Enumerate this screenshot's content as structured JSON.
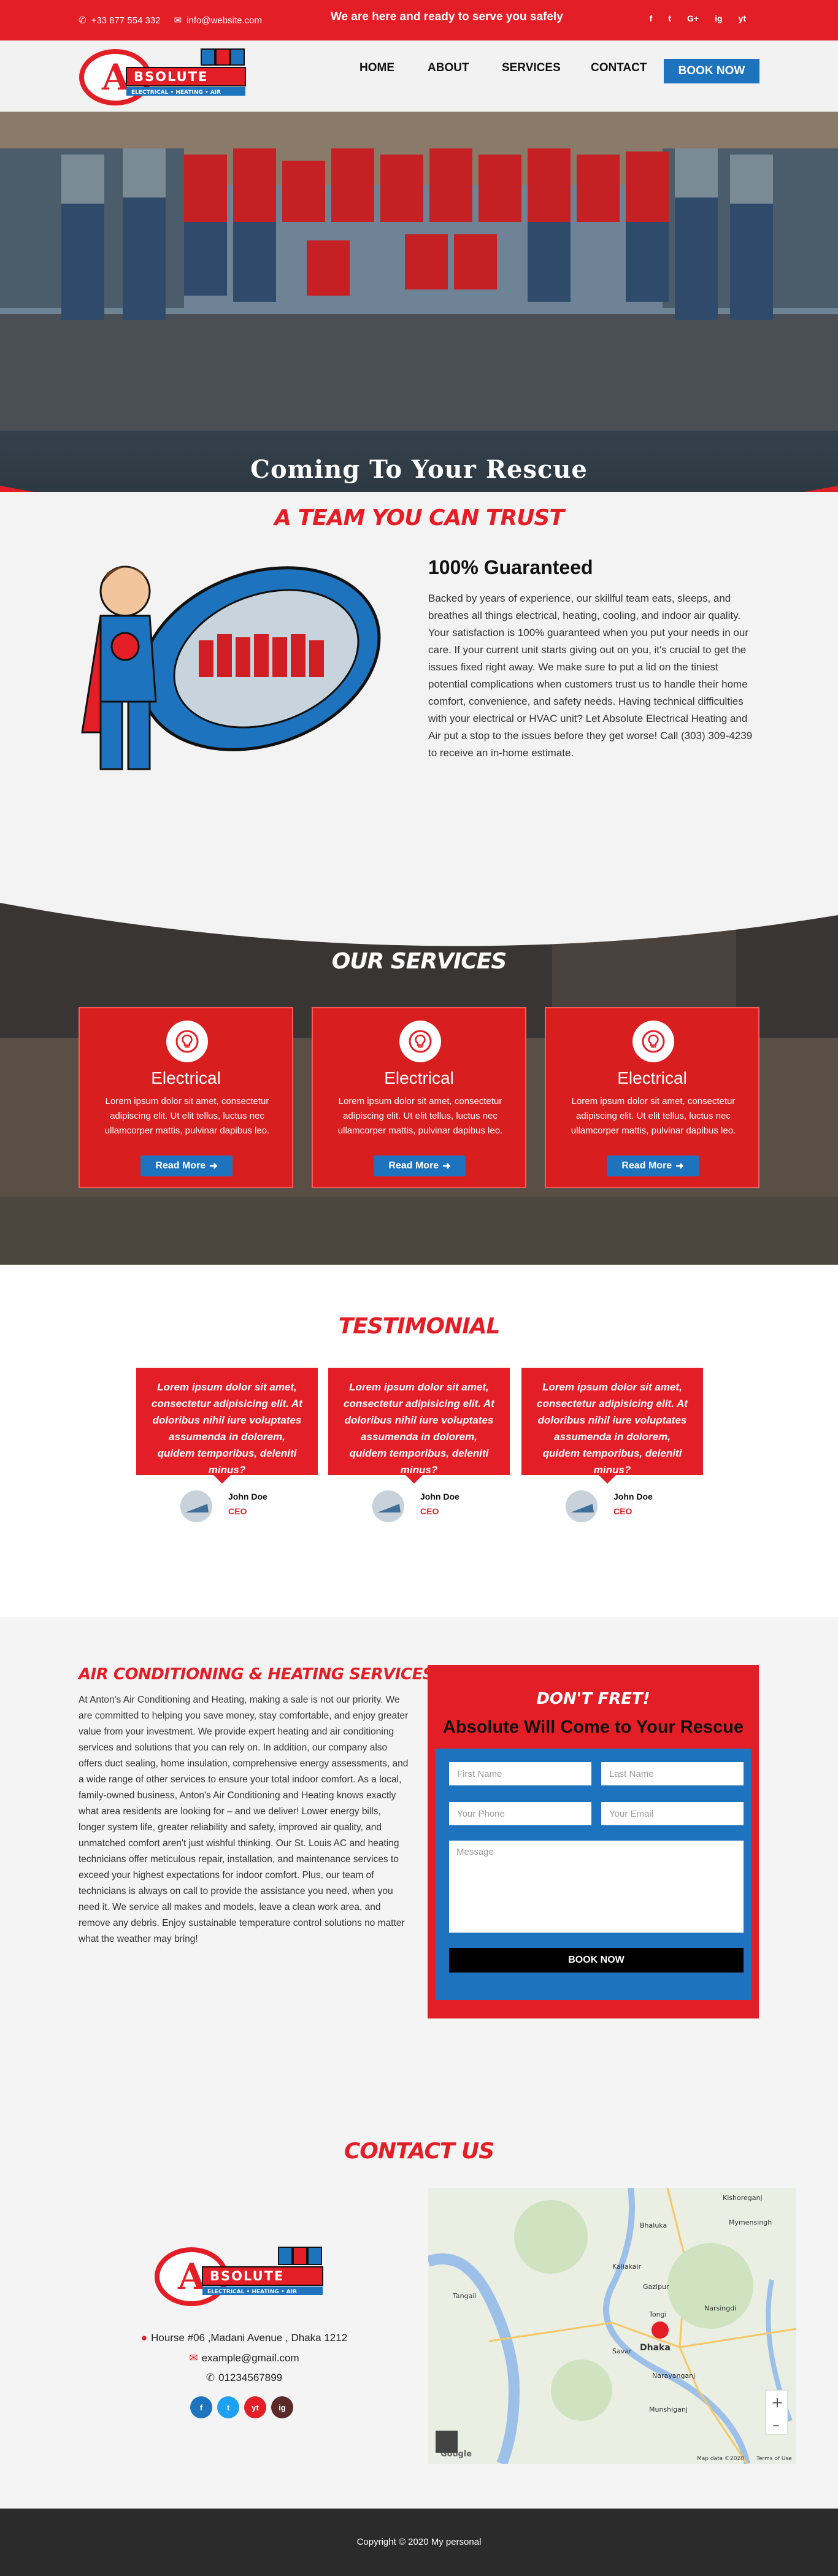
{
  "topbar": {
    "phone": "+33 877 554 332",
    "email": "info@website.com",
    "tagline": "We are here and ready to serve you safely",
    "socials": [
      "f",
      "t",
      "G+",
      "ig",
      "yt"
    ]
  },
  "brand": {
    "logo_letter": "A",
    "logo_word": "BSOLUTE",
    "logo_sub": "ELECTRICAL • HEATING • AIR"
  },
  "nav": {
    "items": [
      "HOME",
      "ABOUT",
      "SERVICES",
      "CONTACT"
    ],
    "cta": "BOOK NOW"
  },
  "hero": {
    "title": "Coming To Your Rescue"
  },
  "trust": {
    "section_title": "A TEAM YOU CAN TRUST",
    "heading": "100% Guaranteed",
    "body": "Backed by years of experience, our skillful team eats, sleeps, and breathes all things electrical, heating, cooling, and indoor air quality. Your satisfaction is 100% guaranteed when you put your needs in our care. If your current unit starts giving out on you, it's crucial to get the issues fixed right away. We make sure to put a lid on the tiniest potential complications when customers trust us to handle their home comfort, convenience, and safety needs. Having technical difficulties with your electrical or HVAC unit? Let Absolute Electrical Heating and Air put a stop to the issues before they get worse! Call (303) 309-4239 to receive an in-home estimate."
  },
  "services": {
    "section_title": "OUR SERVICES",
    "cards": [
      {
        "title": "Electrical",
        "text": "Lorem ipsum dolor sit amet, consectetur adipiscing elit. Ut elit tellus, luctus nec ullamcorper mattis, pulvinar dapibus leo.",
        "button": "Read More"
      },
      {
        "title": "Electrical",
        "text": "Lorem ipsum dolor sit amet, consectetur adipiscing elit. Ut elit tellus, luctus nec ullamcorper mattis, pulvinar dapibus leo.",
        "button": "Read More"
      },
      {
        "title": "Electrical",
        "text": "Lorem ipsum dolor sit amet, consectetur adipiscing elit. Ut elit tellus, luctus nec ullamcorper mattis, pulvinar dapibus leo.",
        "button": "Read More"
      }
    ]
  },
  "testimonial": {
    "section_title": "TESTIMONIAL",
    "items": [
      {
        "quote": "Lorem ipsum dolor sit amet, consectetur adipisicing elit. At doloribus nihil iure voluptates assumenda in dolorem, quidem temporibus, deleniti minus?",
        "name": "John Doe",
        "role": "CEO"
      },
      {
        "quote": "Lorem ipsum dolor sit amet, consectetur adipisicing elit. At doloribus nihil iure voluptates assumenda in dolorem, quidem temporibus, deleniti minus?",
        "name": "John Doe",
        "role": "CEO"
      },
      {
        "quote": "Lorem ipsum dolor sit amet, consectetur adipisicing elit. At doloribus nihil iure voluptates assumenda in dolorem, quidem temporibus, deleniti minus?",
        "name": "John Doe",
        "role": "CEO"
      }
    ]
  },
  "ac": {
    "heading": "AIR CONDITIONING & HEATING SERVICES",
    "body": "At Anton's Air Conditioning and Heating, making a sale is not our priority. We are committed to helping you save money, stay comfortable, and enjoy greater value from your investment. We provide expert heating and air conditioning services and solutions that you can rely on. In addition, our company also offers duct sealing, home insulation, comprehensive energy assessments, and a wide range of other services to ensure your total indoor comfort. As a local, family-owned business, Anton's Air Conditioning and Heating knows exactly what area residents are looking for – and we deliver! Lower energy bills, longer system life, greater reliability and safety, improved air quality, and unmatched comfort aren't just wishful thinking. Our St. Louis AC and heating technicians offer meticulous repair, installation, and maintenance services to exceed your highest expectations for indoor comfort. Plus, our team of technicians is always on call to provide the assistance you need, when you need it. We service all makes and models, leave a clean work area, and remove any debris. Enjoy sustainable temperature control solutions no matter what the weather may bring!"
  },
  "form": {
    "title1": "DON'T FRET!",
    "title2": "Absolute Will Come to Your Rescue",
    "first_name": "First Name",
    "last_name": "Last Name",
    "phone": "Your Phone",
    "email": "Your Email",
    "message": "Message",
    "submit": "BOOK NOW"
  },
  "contact": {
    "section_title": "CONTACT US",
    "address": "Hourse #06 ,Madani Avenue , Dhaka 1212",
    "email": "example@gmail.com",
    "phone": "01234567899",
    "socials": [
      "f",
      "t",
      "yt",
      "ig"
    ],
    "map_labels": [
      "Kishoreganj",
      "Bhaluka",
      "Mymensingh",
      "Tangail",
      "Gazipur",
      "Dhaka",
      "Narayanganj",
      "Munshiganj",
      "Tongi",
      "Kaliakair",
      "Savar",
      "Narsingdi",
      "Google",
      "Map data ©2020",
      "Terms of Use"
    ]
  },
  "footer": {
    "copyright": "Copyright © 2020 My personal"
  },
  "colors": {
    "primary_red": "#e41e26",
    "accent_blue": "#1e73be",
    "footer_dark": "#2b2b2b"
  }
}
